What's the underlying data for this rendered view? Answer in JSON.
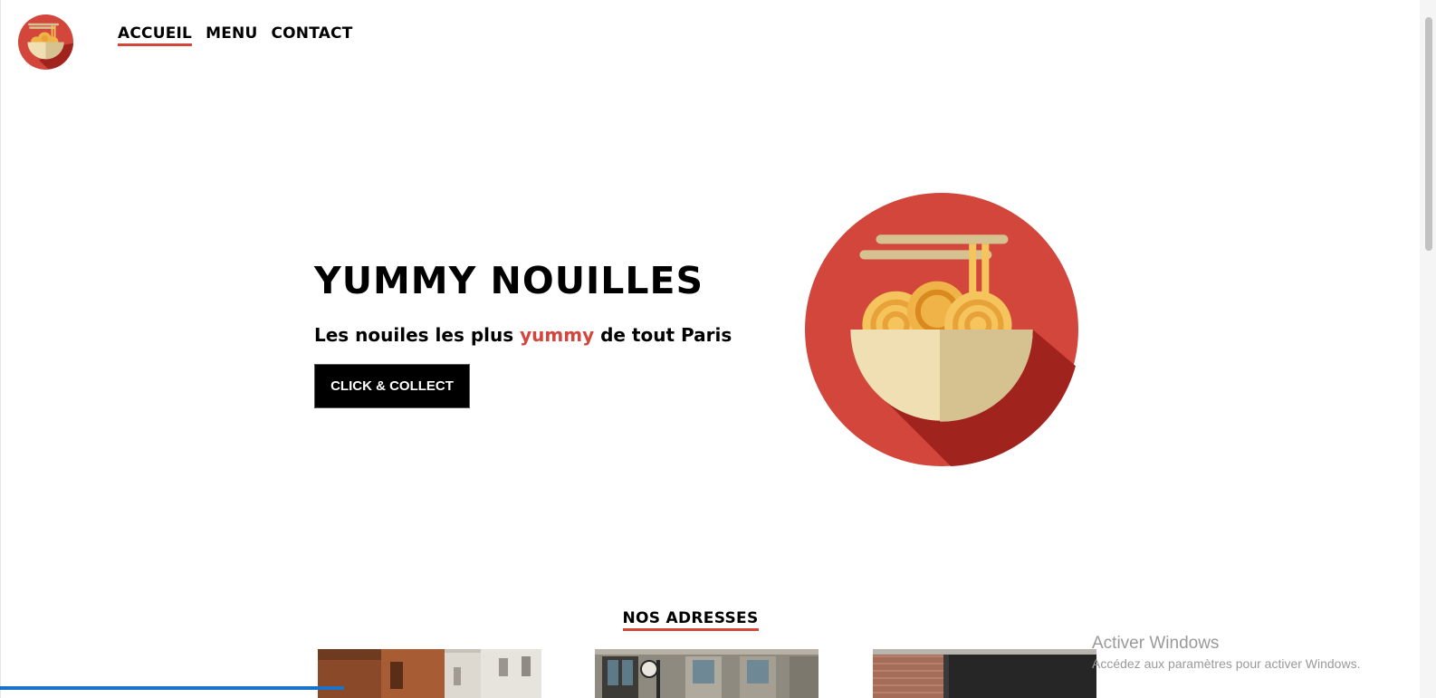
{
  "brand": {
    "logo_icon": "noodle-bowl-icon",
    "colors": {
      "accent": "#d2463c",
      "dark": "#000000"
    }
  },
  "nav": {
    "items": [
      {
        "label": "ACCUEIL",
        "active": true
      },
      {
        "label": "MENU",
        "active": false
      },
      {
        "label": "CONTACT",
        "active": false
      }
    ]
  },
  "hero": {
    "title": "YUMMY NOUILLES",
    "subtitle_before": "Les nouiles les plus ",
    "subtitle_accent": "yummy",
    "subtitle_after": " de tout Paris",
    "cta_label": "CLICK & COLLECT",
    "image_icon": "noodle-bowl-icon"
  },
  "addresses": {
    "title": "NOS ADRESSES",
    "photos": [
      "street-photo",
      "storefront-photo",
      "restaurant-facade-photo"
    ]
  },
  "os_watermark": {
    "title": "Activer Windows",
    "subtitle": "Accédez aux paramètres pour activer Windows."
  }
}
